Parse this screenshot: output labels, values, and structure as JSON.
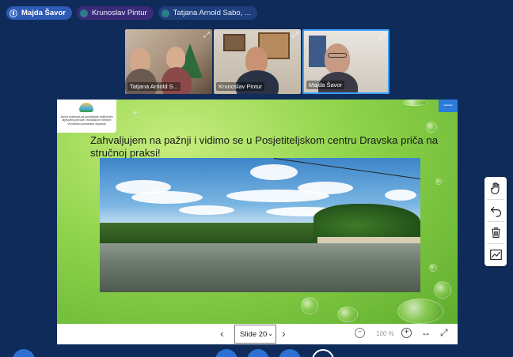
{
  "participants": [
    {
      "name": "Majda Šavor",
      "talking": true
    },
    {
      "name": "Krunoslav Pintur"
    },
    {
      "name": "Tatjana Arnold Sabo, ..."
    }
  ],
  "videos": [
    {
      "name": "Tatjana Arnold S..."
    },
    {
      "name": "Krunoslav Pintur"
    },
    {
      "name": "Majda Šavor"
    }
  ],
  "slide": {
    "logo_text": "Javna ustanova za upravljanje zaštićenim dijelovima prirode i ekološkom mrežom Virovitičko-podravske županije",
    "title": "Zahvaljujem na pažnji i vidimo se u Posjetiteljskom centru Dravska priča na stručnoj praksi!"
  },
  "nav": {
    "slide_label": "Slide 20",
    "zoom": "100 %",
    "minimize_symbol": "—"
  },
  "toolbar": {
    "items": [
      "hand-tool",
      "undo",
      "delete",
      "whiteboard-chart"
    ]
  },
  "colors": {
    "background": "#0f2b5a",
    "accent": "#2b7bd9",
    "slide_green": "#8ed34a"
  }
}
